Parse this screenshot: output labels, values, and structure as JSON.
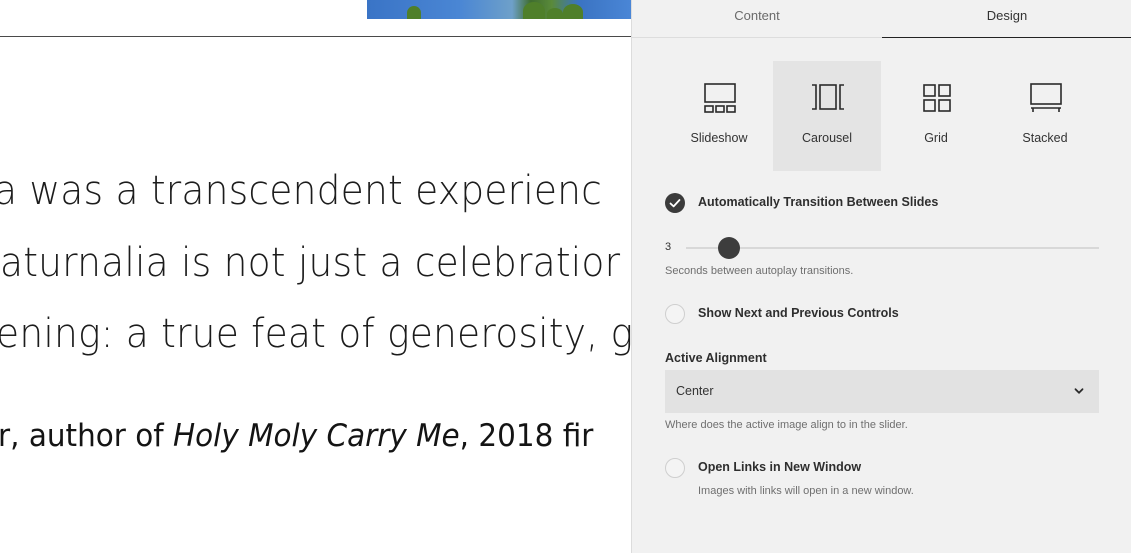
{
  "background_page": {
    "quote_lines": [
      "a was a transcendent experienc",
      "aturnalia is not just a celebratior",
      "ening: a true feat of generosity, g"
    ],
    "attribution_prefix": "r, author of ",
    "attribution_title": "Holy Moly Carry Me",
    "attribution_suffix": ", 2018 fir"
  },
  "panel": {
    "tabs": [
      {
        "label": "Content"
      },
      {
        "label": "Design"
      }
    ],
    "active_tab": "Design",
    "layouts": [
      {
        "label": "Slideshow",
        "icon": "slideshow-icon",
        "selected": false
      },
      {
        "label": "Carousel",
        "icon": "carousel-icon",
        "selected": true
      },
      {
        "label": "Grid",
        "icon": "grid-icon",
        "selected": false
      },
      {
        "label": "Stacked",
        "icon": "stacked-icon",
        "selected": false
      }
    ],
    "auto_transition": {
      "label": "Automatically Transition Between Slides",
      "checked": true
    },
    "autoplay": {
      "value": "3",
      "min": 1,
      "max": 20,
      "help": "Seconds between autoplay transitions."
    },
    "show_controls": {
      "label": "Show Next and Previous Controls",
      "checked": false
    },
    "active_alignment": {
      "label": "Active Alignment",
      "value": "Center",
      "help": "Where does the active image align to in the slider."
    },
    "open_links": {
      "label": "Open Links in New Window",
      "checked": false,
      "help": "Images with links will open in a new window."
    }
  },
  "colors": {
    "panel_bg": "#f1f1f1",
    "selected_layout_bg": "#e4e4e4",
    "accent_dark": "#3b3b3b"
  }
}
